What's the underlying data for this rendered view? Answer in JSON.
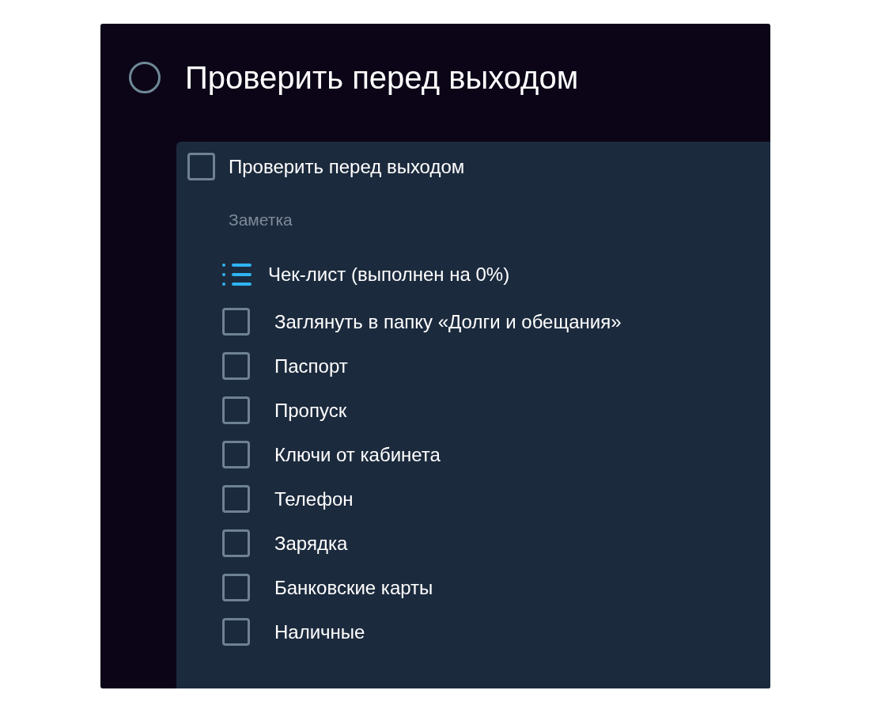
{
  "task": {
    "title": "Проверить перед выходом",
    "done": false
  },
  "card": {
    "title": "Проверить перед выходом",
    "checked": false,
    "note": {
      "placeholder": "Заметка"
    }
  },
  "checklist": {
    "title": "Чек-лист (выполнен на 0%)",
    "items": [
      {
        "label": "Заглянуть в папку «Долги и обещания»",
        "checked": false
      },
      {
        "label": "Паспорт",
        "checked": false
      },
      {
        "label": "Пропуск",
        "checked": false
      },
      {
        "label": "Ключи от кабинета",
        "checked": false
      },
      {
        "label": "Телефон",
        "checked": false
      },
      {
        "label": "Зарядка",
        "checked": false
      },
      {
        "label": "Банковские карты",
        "checked": false
      },
      {
        "label": "Наличные",
        "checked": false
      }
    ]
  }
}
